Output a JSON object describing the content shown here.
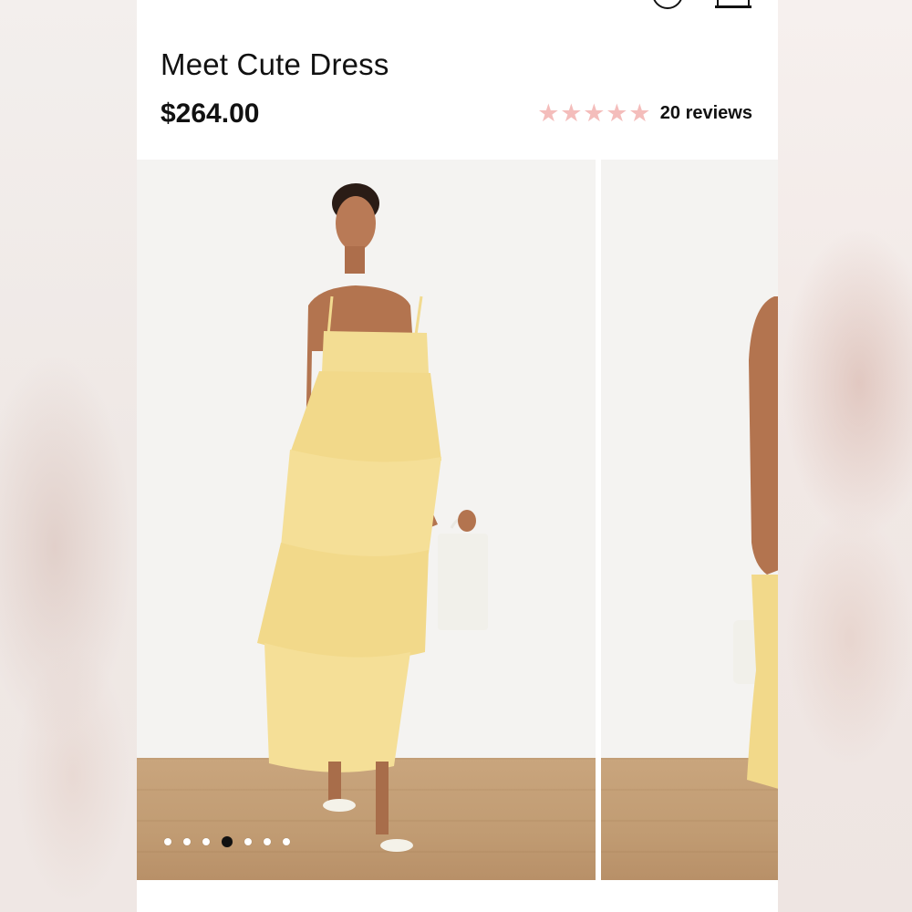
{
  "header": {
    "icons": [
      "menu-icon",
      "search-icon",
      "logo-icon",
      "account-icon",
      "bag-icon"
    ]
  },
  "product": {
    "title": "Meet Cute Dress",
    "price": "$264.00",
    "rating": {
      "stars": 5,
      "star_color": "#f4bdbb",
      "reviews_label": "20 reviews"
    }
  },
  "gallery": {
    "slide_count": 7,
    "active_index": 3,
    "dress_color": "#f3dd93"
  }
}
